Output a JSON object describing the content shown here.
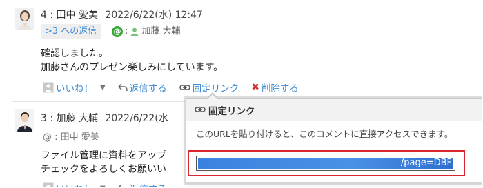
{
  "comments": [
    {
      "number": "4",
      "author": "田中 愛美",
      "datetime": "2022/6/22(水) 12:47",
      "reply_tag": ">3 への返信",
      "mention_prefix": ":",
      "mention_user": "加藤 大輔",
      "body_lines": [
        "確認しました。",
        "加藤さんのプレゼン楽しみにしています。"
      ],
      "actions": {
        "like": "いいね！",
        "reply": "返信する",
        "permalink": "固定リンク",
        "delete": "削除する"
      }
    },
    {
      "number": "3",
      "author": "加藤 大輔",
      "datetime": "2022/6/22(水",
      "mention": "@ : 田中 愛美",
      "body_lines": [
        "ファイル管理に資料をアップ",
        "チェックをよろしくお願いい"
      ],
      "actions": {
        "like": "いいね！",
        "reply": "返信する"
      }
    }
  ],
  "popup": {
    "title": "固定リンク",
    "description": "このURLを貼り付けると、このコメントに直接アクセスできます。",
    "url_visible": "/page=DBF"
  },
  "colors": {
    "link": "#3d8bd4",
    "mention_green": "#38a838",
    "delete_red": "#d23535",
    "highlight_red": "#d9262e",
    "selection_blue": "#3b82e0"
  },
  "icons": [
    "woman-avatar",
    "man-avatar",
    "at-icon",
    "user-icon",
    "thumb-icon",
    "reply-icon",
    "link-icon",
    "delete-x-icon"
  ]
}
